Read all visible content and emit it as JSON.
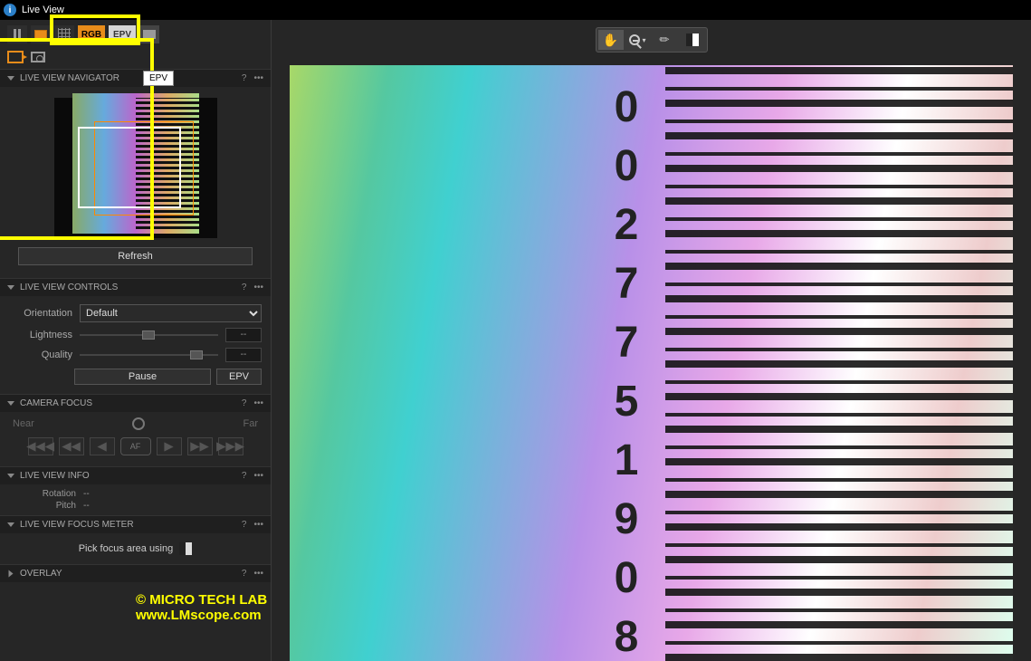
{
  "window": {
    "title": "Live View"
  },
  "toolbar": {
    "rgb": "RGB",
    "epv": "EPV",
    "tooltip": "EPV"
  },
  "panels": {
    "navigator": {
      "title": "LIVE VIEW NAVIGATOR",
      "refresh": "Refresh"
    },
    "controls": {
      "title": "LIVE VIEW CONTROLS",
      "orientation_label": "Orientation",
      "orientation_value": "Default",
      "lightness_label": "Lightness",
      "lightness_value": "--",
      "quality_label": "Quality",
      "quality_value": "--",
      "pause": "Pause",
      "epv": "EPV"
    },
    "camera_focus": {
      "title": "CAMERA FOCUS",
      "near": "Near",
      "far": "Far",
      "af": "AF"
    },
    "info": {
      "title": "LIVE VIEW INFO",
      "rotation_label": "Rotation",
      "rotation_value": "--",
      "pitch_label": "Pitch",
      "pitch_value": "--"
    },
    "focus_meter": {
      "title": "LIVE VIEW FOCUS METER",
      "pick_text": "Pick focus area using"
    },
    "overlay": {
      "title": "OVERLAY"
    }
  },
  "help": "?",
  "more": "•••",
  "watermark": "© MICRO TECH LAB   www.LMscope.com",
  "barcode_number": "0027751908"
}
